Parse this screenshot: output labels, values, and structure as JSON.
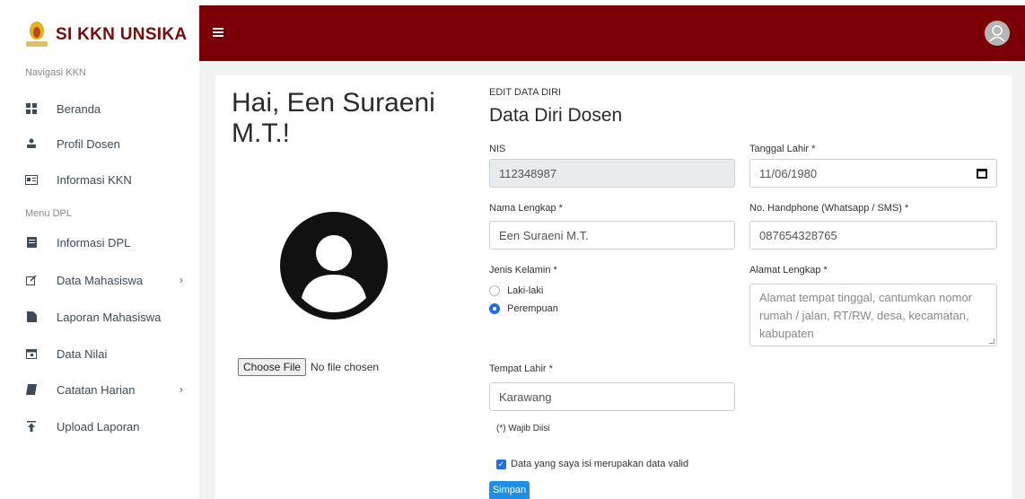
{
  "brand": {
    "title": "SI KKN UNSIKA",
    "logo_icon": "unsika-logo"
  },
  "sidebar": {
    "sections": [
      {
        "label": "Navigasi KKN"
      },
      {
        "label": "Menu DPL"
      }
    ],
    "items": [
      {
        "label": "Beranda",
        "icon": "dashboard-icon"
      },
      {
        "label": "Profil Dosen",
        "icon": "user-icon"
      },
      {
        "label": "Informasi KKN",
        "icon": "id-card-icon"
      },
      {
        "label": "Informasi DPL",
        "icon": "document-icon"
      },
      {
        "label": "Data Mahasiswa",
        "icon": "edit-icon",
        "chevron": "›"
      },
      {
        "label": "Laporan Mahasiswa",
        "icon": "file-icon"
      },
      {
        "label": "Data Nilai",
        "icon": "calendar-icon"
      },
      {
        "label": "Catatan Harian",
        "icon": "book-icon",
        "chevron": "›"
      },
      {
        "label": "Upload Laporan",
        "icon": "upload-icon"
      }
    ]
  },
  "topbar": {
    "color": "#7a0005",
    "menu_icon": "hamburger-icon",
    "avatar_icon": "user-avatar-icon"
  },
  "profile": {
    "greeting": "Hai, Een Suraeni M.T.!",
    "file_button": "Choose File",
    "file_status": "No file chosen"
  },
  "form": {
    "kicker": "EDIT DATA DIRI",
    "title": "Data Diri Dosen",
    "nis": {
      "label": "NIS",
      "value": "112348987"
    },
    "tanggal_lahir": {
      "label": "Tanggal Lahir *",
      "value": "11/06/1980"
    },
    "nama": {
      "label": "Nama Lengkap *",
      "value": "Een Suraeni M.T."
    },
    "handphone": {
      "label": "No. Handphone (Whatsapp / SMS) *",
      "value": "087654328765"
    },
    "jenis_kelamin": {
      "label": "Jenis Kelamin *",
      "options": [
        "Laki-laki",
        "Perempuan"
      ],
      "selected": "Perempuan"
    },
    "alamat": {
      "label": "Alamat Lengkap *",
      "placeholder": "Alamat tempat tinggal, cantumkan nomor rumah / jalan, RT/RW, desa, kecamatan, kabupaten"
    },
    "tempat_lahir": {
      "label": "Tempat Lahir *",
      "value": "Karawang"
    },
    "required_note": "(*) Wajib Diisi",
    "valid_check": {
      "label": "Data yang saya isi merupakan data valid",
      "checked": true
    },
    "submit_label": "Simpan"
  }
}
